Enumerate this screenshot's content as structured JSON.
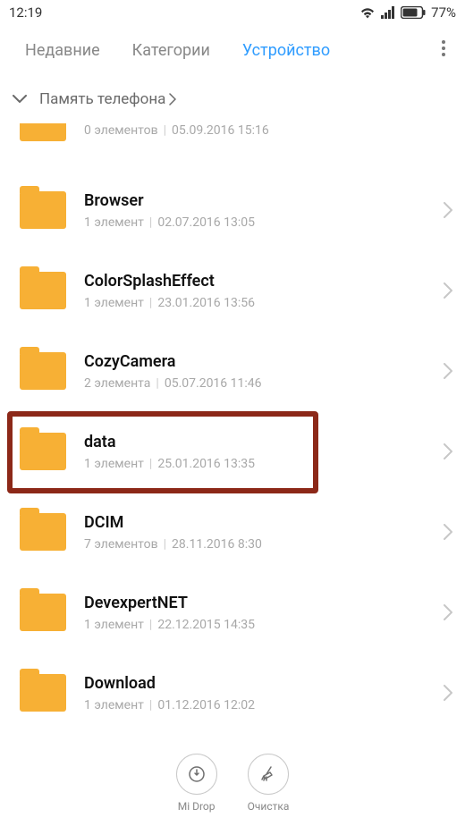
{
  "status": {
    "time": "12:19",
    "battery": "77%"
  },
  "tabs": {
    "recent": "Недавние",
    "categories": "Категории",
    "device": "Устройство"
  },
  "breadcrumb": {
    "phone_memory": "Память телефона"
  },
  "folders": [
    {
      "name": "",
      "count": "0 элементов",
      "date": "05.09.2016 15:16",
      "partial": true
    },
    {
      "name": "Browser",
      "count": "1 элемент",
      "date": "02.07.2016 13:05"
    },
    {
      "name": "ColorSplashEffect",
      "count": "1 элемент",
      "date": "23.01.2016 13:56"
    },
    {
      "name": "CozyCamera",
      "count": "2 элемента",
      "date": "05.07.2016 11:46"
    },
    {
      "name": "data",
      "count": "1 элемент",
      "date": "25.01.2016 13:35",
      "highlighted": true
    },
    {
      "name": "DCIM",
      "count": "7 элементов",
      "date": "28.11.2016 8:30"
    },
    {
      "name": "DevexpertNET",
      "count": "1 элемент",
      "date": "22.12.2015 14:35"
    },
    {
      "name": "Download",
      "count": "1 элемент",
      "date": "01.12.2016 12:02"
    }
  ],
  "actions": {
    "midrop": "Mi Drop",
    "clean": "Очистка"
  }
}
